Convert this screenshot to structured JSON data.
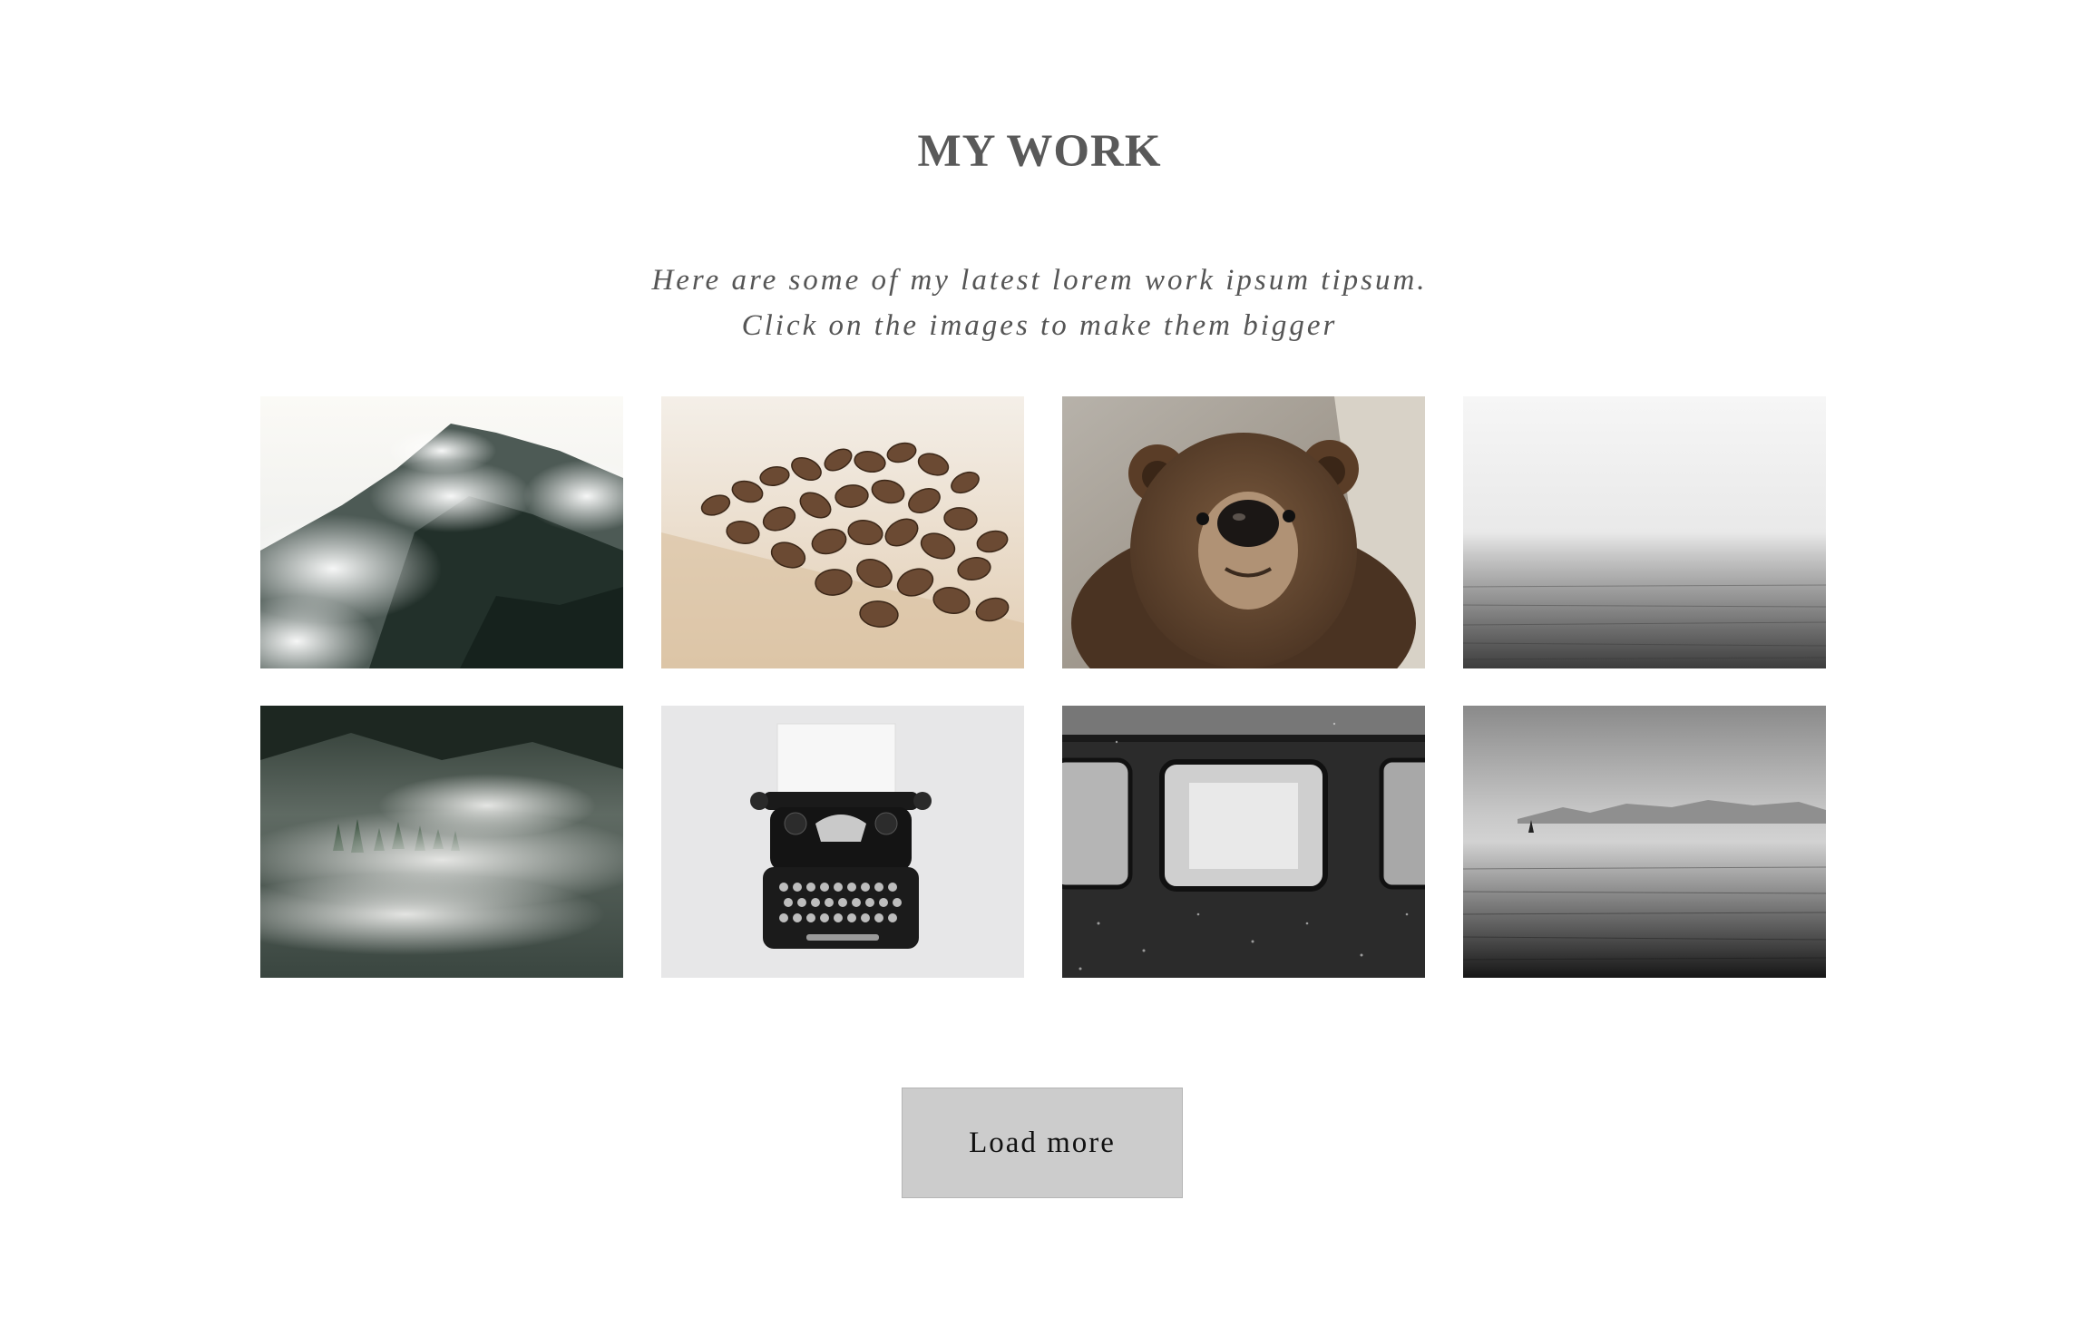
{
  "section": {
    "title": "MY WORK",
    "subtitle_line1": "Here are some of my latest lorem work ipsum tipsum.",
    "subtitle_line2": "Click on the images to make them bigger"
  },
  "gallery": {
    "images": [
      {
        "subject": "misty-mountain"
      },
      {
        "subject": "coffee-beans"
      },
      {
        "subject": "brown-bear"
      },
      {
        "subject": "foggy-sea"
      },
      {
        "subject": "foggy-forest"
      },
      {
        "subject": "typewriter"
      },
      {
        "subject": "train-windows"
      },
      {
        "subject": "sea-with-sailboat"
      }
    ]
  },
  "load_more_label": "Load more",
  "colors": {
    "text": "#555555",
    "button_bg": "#cccccc",
    "button_border": "#b5b5b5",
    "background": "#ffffff"
  }
}
